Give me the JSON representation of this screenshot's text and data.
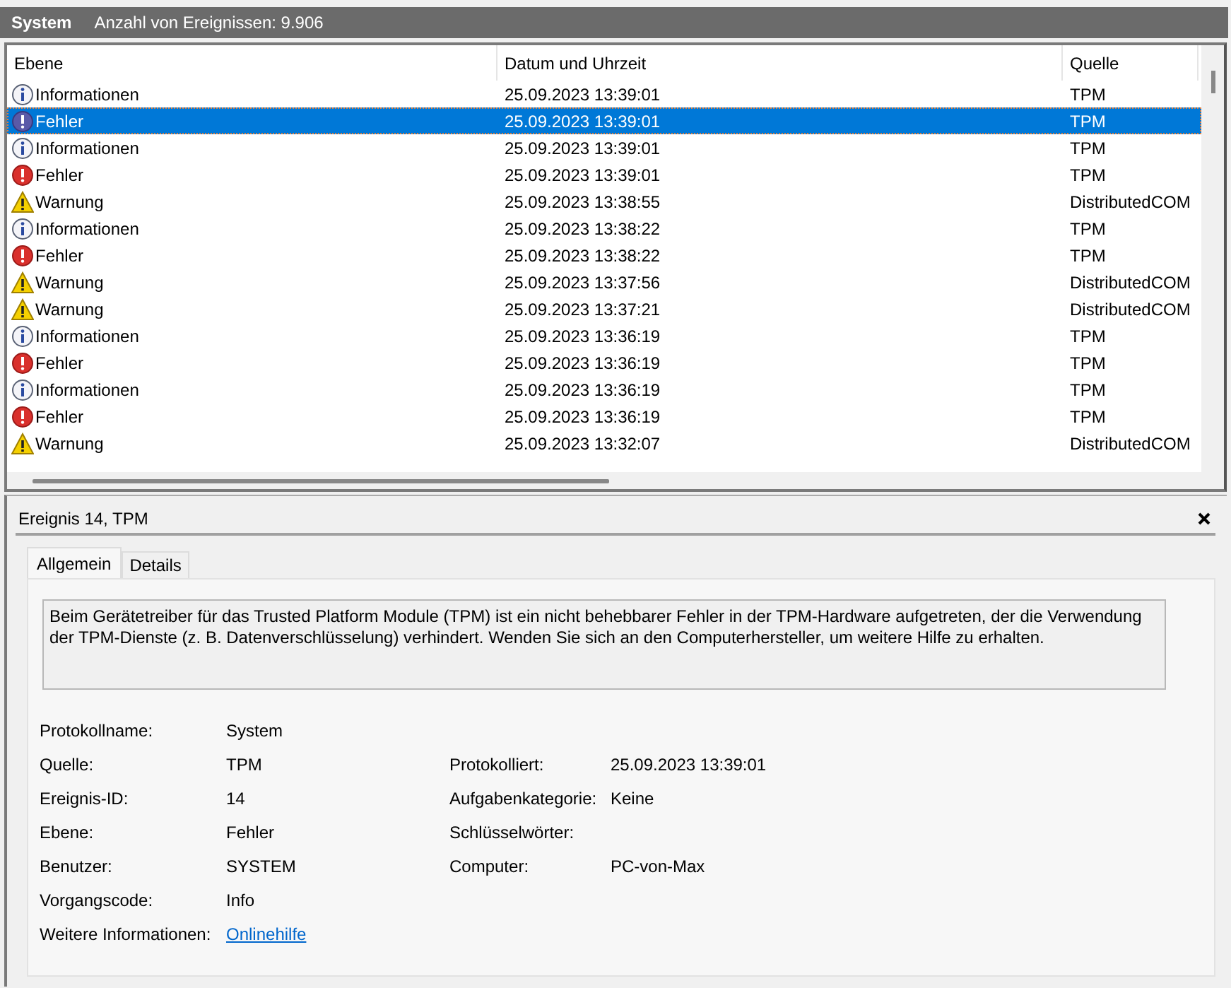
{
  "header": {
    "title": "System",
    "count": "Anzahl von Ereignissen: 9.906"
  },
  "table": {
    "columns": [
      "Ebene",
      "Datum und Uhrzeit",
      "Quelle"
    ],
    "rows": [
      {
        "kind": "info",
        "level": "Informationen",
        "datetime": "25.09.2023 13:39:01",
        "source": "TPM",
        "selected": false
      },
      {
        "kind": "error",
        "level": "Fehler",
        "datetime": "25.09.2023 13:39:01",
        "source": "TPM",
        "selected": true
      },
      {
        "kind": "info",
        "level": "Informationen",
        "datetime": "25.09.2023 13:39:01",
        "source": "TPM",
        "selected": false
      },
      {
        "kind": "error",
        "level": "Fehler",
        "datetime": "25.09.2023 13:39:01",
        "source": "TPM",
        "selected": false
      },
      {
        "kind": "warning",
        "level": "Warnung",
        "datetime": "25.09.2023 13:38:55",
        "source": "DistributedCOM",
        "selected": false
      },
      {
        "kind": "info",
        "level": "Informationen",
        "datetime": "25.09.2023 13:38:22",
        "source": "TPM",
        "selected": false
      },
      {
        "kind": "error",
        "level": "Fehler",
        "datetime": "25.09.2023 13:38:22",
        "source": "TPM",
        "selected": false
      },
      {
        "kind": "warning",
        "level": "Warnung",
        "datetime": "25.09.2023 13:37:56",
        "source": "DistributedCOM",
        "selected": false
      },
      {
        "kind": "warning",
        "level": "Warnung",
        "datetime": "25.09.2023 13:37:21",
        "source": "DistributedCOM",
        "selected": false
      },
      {
        "kind": "info",
        "level": "Informationen",
        "datetime": "25.09.2023 13:36:19",
        "source": "TPM",
        "selected": false
      },
      {
        "kind": "error",
        "level": "Fehler",
        "datetime": "25.09.2023 13:36:19",
        "source": "TPM",
        "selected": false
      },
      {
        "kind": "info",
        "level": "Informationen",
        "datetime": "25.09.2023 13:36:19",
        "source": "TPM",
        "selected": false
      },
      {
        "kind": "error",
        "level": "Fehler",
        "datetime": "25.09.2023 13:36:19",
        "source": "TPM",
        "selected": false
      },
      {
        "kind": "warning",
        "level": "Warnung",
        "datetime": "25.09.2023 13:32:07",
        "source": "DistributedCOM",
        "selected": false
      }
    ]
  },
  "detail": {
    "title": "Ereignis 14, TPM",
    "tabs": [
      {
        "label": "Allgemein",
        "selected": true
      },
      {
        "label": "Details",
        "selected": false
      }
    ],
    "description": "Beim Gerätetreiber für das Trusted Platform Module (TPM) ist ein nicht behebbarer Fehler in der TPM-Hardware aufgetreten, der die Verwendung der TPM-Dienste (z. B. Datenverschlüsselung) verhindert. Wenden Sie sich an den Computerhersteller, um weitere Hilfe zu erhalten.",
    "properties": [
      {
        "left": {
          "label": "Protokollname:",
          "value": "System"
        }
      },
      {
        "left": {
          "label": "Quelle:",
          "value": "TPM"
        },
        "right": {
          "label": "Protokolliert:",
          "value": "25.09.2023 13:39:01"
        }
      },
      {
        "left": {
          "label": "Ereignis-ID:",
          "value": "14"
        },
        "right": {
          "label": "Aufgabenkategorie:",
          "value": "Keine"
        }
      },
      {
        "left": {
          "label": "Ebene:",
          "value": "Fehler"
        },
        "right": {
          "label": "Schlüsselwörter:"
        }
      },
      {
        "left": {
          "label": "Benutzer:",
          "value": "SYSTEM"
        },
        "right": {
          "label": "Computer:",
          "value": "PC-von-Max"
        }
      },
      {
        "left": {
          "label": "Vorgangscode:",
          "value": "Info"
        }
      },
      {
        "left": {
          "label": "Weitere Informationen:",
          "value": "Onlinehilfe",
          "kind": "link"
        }
      }
    ]
  }
}
